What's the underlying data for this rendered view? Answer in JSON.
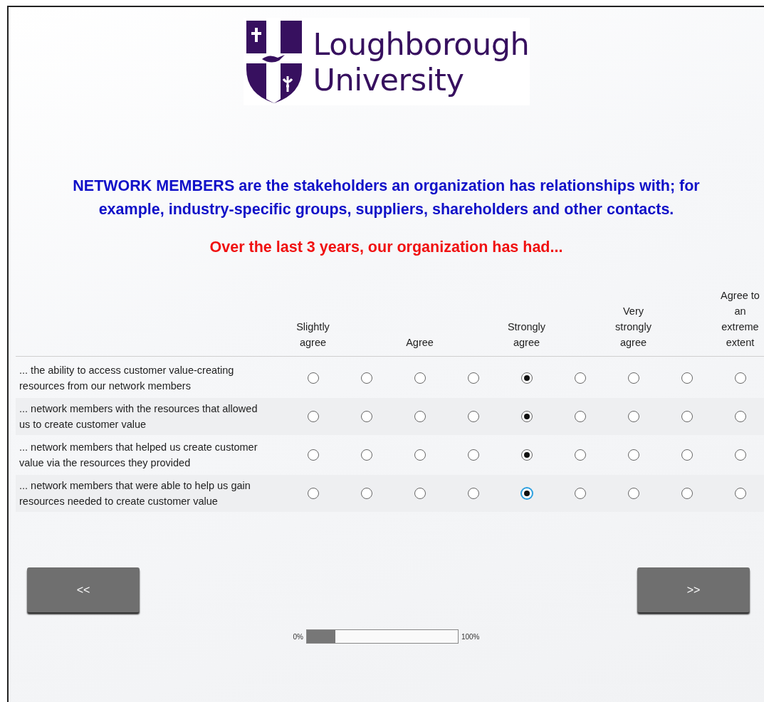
{
  "logo": {
    "lines": [
      "Loughborough",
      "University"
    ]
  },
  "intro": "NETWORK MEMBERS are the stakeholders an organization has relationships with; for example, industry-specific groups, suppliers, shareholders and other contacts.",
  "prompt": "Over the last 3 years, our organization has had...",
  "scale_labels": [
    "Slightly agree",
    "Agree",
    "Strongly agree",
    "Very strongly agree",
    "Agree to an extreme extent"
  ],
  "rows": [
    {
      "statement": "... the ability to access customer value-creating resources from our network members",
      "options": [
        {
          "selected": false
        },
        {
          "selected": false
        },
        {
          "selected": false
        },
        {
          "selected": false
        },
        {
          "selected": true
        },
        {
          "selected": false
        },
        {
          "selected": false
        },
        {
          "selected": false
        },
        {
          "selected": false
        }
      ]
    },
    {
      "statement": "... network members with the resources that allowed us to create customer value",
      "options": [
        {
          "selected": false
        },
        {
          "selected": false
        },
        {
          "selected": false
        },
        {
          "selected": false
        },
        {
          "selected": true
        },
        {
          "selected": false
        },
        {
          "selected": false
        },
        {
          "selected": false
        },
        {
          "selected": false
        }
      ]
    },
    {
      "statement": "... network members that helped us create customer value via the resources they provided",
      "options": [
        {
          "selected": false
        },
        {
          "selected": false
        },
        {
          "selected": false
        },
        {
          "selected": false
        },
        {
          "selected": true
        },
        {
          "selected": false
        },
        {
          "selected": false
        },
        {
          "selected": false
        },
        {
          "selected": false
        }
      ]
    },
    {
      "statement": "... network members that were able to help us gain resources needed to create customer value",
      "options": [
        {
          "selected": false
        },
        {
          "selected": false
        },
        {
          "selected": false
        },
        {
          "selected": false
        },
        {
          "selected": true,
          "focused": true
        },
        {
          "selected": false
        },
        {
          "selected": false
        },
        {
          "selected": false
        },
        {
          "selected": false
        }
      ]
    }
  ],
  "buttons": {
    "back": "<<",
    "next": ">>"
  },
  "progress": {
    "start": "0%",
    "end": "100%",
    "level": 0.19
  }
}
